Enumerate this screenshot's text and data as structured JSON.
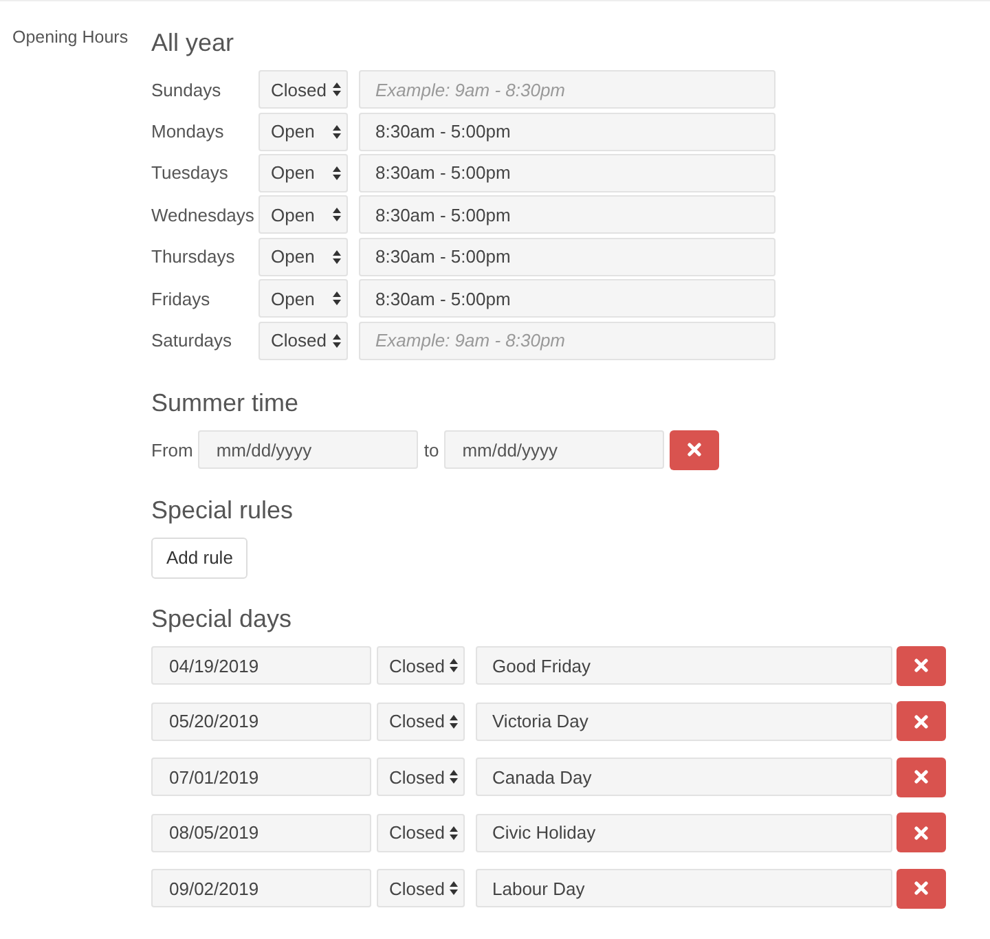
{
  "field_label": "Opening Hours",
  "all_year": {
    "title": "All year",
    "days": [
      {
        "day": "Sundays",
        "status": "Closed",
        "placeholder": "Example: 9am - 8:30pm"
      },
      {
        "day": "Mondays",
        "status": "Open",
        "hours": "8:30am - 5:00pm"
      },
      {
        "day": "Tuesdays",
        "status": "Open",
        "hours": "8:30am - 5:00pm"
      },
      {
        "day": "Wednesdays",
        "status": "Open",
        "hours": "8:30am - 5:00pm"
      },
      {
        "day": "Thursdays",
        "status": "Open",
        "hours": "8:30am - 5:00pm"
      },
      {
        "day": "Fridays",
        "status": "Open",
        "hours": "8:30am - 5:00pm"
      },
      {
        "day": "Saturdays",
        "status": "Closed",
        "placeholder": "Example: 9am - 8:30pm"
      }
    ]
  },
  "summer_time": {
    "title": "Summer time",
    "from_label": "From",
    "from_placeholder": "mm/dd/yyyy",
    "to_label": "to",
    "to_placeholder": "mm/dd/yyyy"
  },
  "special_rules": {
    "title": "Special rules",
    "button": "Add rule"
  },
  "special_days": {
    "title": "Special days",
    "rows": [
      {
        "date": "04/19/2019",
        "status": "Closed",
        "name": "Good Friday"
      },
      {
        "date": "05/20/2019",
        "status": "Closed",
        "name": "Victoria Day"
      },
      {
        "date": "07/01/2019",
        "status": "Closed",
        "name": "Canada Day"
      },
      {
        "date": "08/05/2019",
        "status": "Closed",
        "name": "Civic Holiday"
      },
      {
        "date": "09/02/2019",
        "status": "Closed",
        "name": "Labour Day"
      }
    ]
  }
}
